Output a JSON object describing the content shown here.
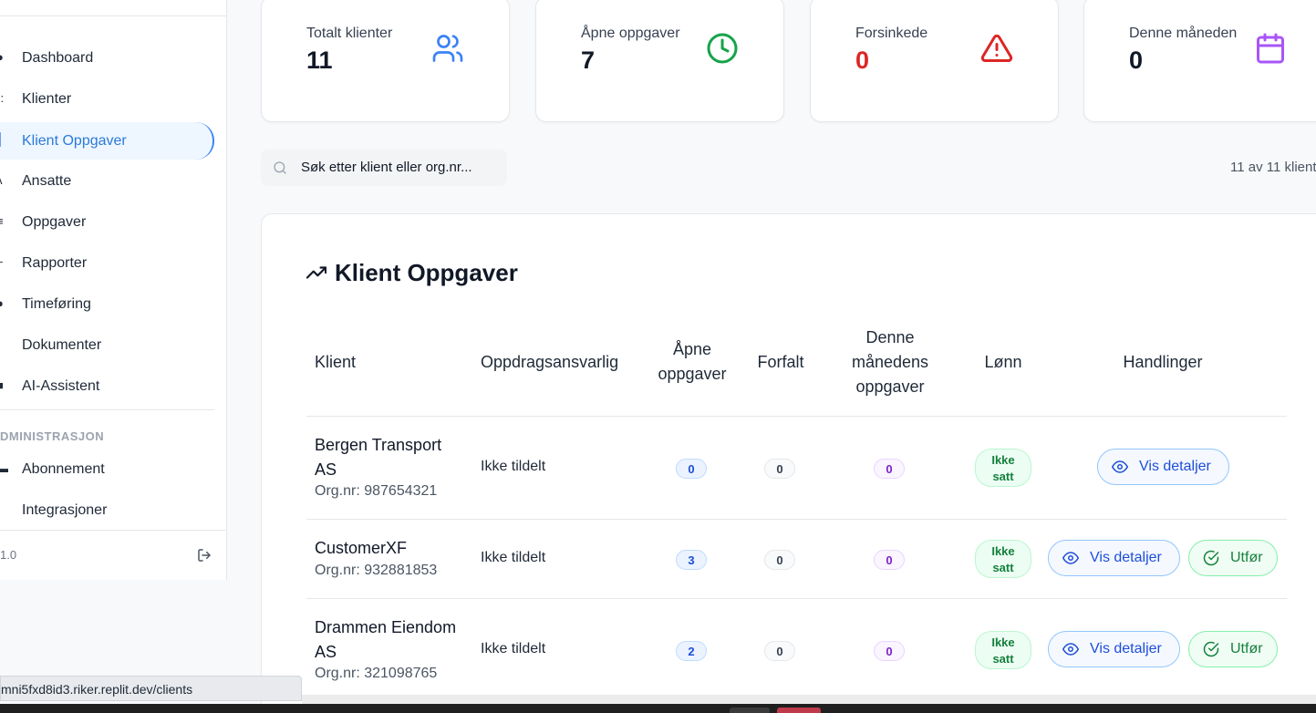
{
  "sidebar": {
    "items": [
      {
        "label": "Dashboard",
        "icon": "dashboard-icon"
      },
      {
        "label": "Klienter",
        "icon": "users-icon"
      },
      {
        "label": "Klient Oppgaver",
        "icon": "clipboard-icon",
        "active": true
      },
      {
        "label": "Ansatte",
        "icon": "person-icon"
      },
      {
        "label": "Oppgaver",
        "icon": "list-icon"
      },
      {
        "label": "Rapporter",
        "icon": "chart-icon"
      },
      {
        "label": "Timeføring",
        "icon": "clock-icon"
      },
      {
        "label": "Dokumenter",
        "icon": "file-icon"
      },
      {
        "label": "AI-Assistent",
        "icon": "bot-icon"
      }
    ],
    "admin_section": "DMINISTRASJON",
    "admin_items": [
      {
        "label": "Abonnement",
        "icon": "card-icon"
      },
      {
        "label": "Integrasjoner",
        "icon": "plug-icon"
      }
    ],
    "version": "1.0",
    "logout_icon": "logout-icon"
  },
  "stats": [
    {
      "label": "Totalt klienter",
      "value": "11",
      "icon": "users-icon",
      "color": "#3b82f6"
    },
    {
      "label": "Åpne oppgaver",
      "value": "7",
      "icon": "clock-icon",
      "color": "#16a34a"
    },
    {
      "label": "Forsinkede",
      "value": "0",
      "icon": "warning-icon",
      "color": "#dc2626"
    },
    {
      "label": "Denne måneden",
      "value": "0",
      "icon": "calendar-icon",
      "color": "#a855f7"
    }
  ],
  "search": {
    "placeholder": "Søk etter klient eller org.nr...",
    "count_text": "11 av 11 klient"
  },
  "panel": {
    "title": "Klient Oppgaver",
    "title_icon": "trending-up-icon"
  },
  "table": {
    "headers": {
      "client": "Klient",
      "responsible": "Oppdragsansvarlig",
      "open_line1": "Åpne",
      "open_line2": "oppgaver",
      "overdue": "Forfalt",
      "month_line1": "Denne",
      "month_line2": "månedens",
      "month_line3": "oppgaver",
      "salary": "Lønn",
      "actions": "Handlinger"
    },
    "rows": [
      {
        "name_line1": "Bergen Transport",
        "name_line2": "AS",
        "org": "Org.nr: 987654321",
        "responsible": "Ikke tildelt",
        "open": "0",
        "overdue": "0",
        "month": "0",
        "salary_line1": "Ikke",
        "salary_line2": "satt",
        "details": "Vis detaljer"
      },
      {
        "name_line1": "CustomerXF",
        "name_line2": "",
        "org": "Org.nr: 932881853",
        "responsible": "Ikke tildelt",
        "open": "3",
        "overdue": "0",
        "month": "0",
        "salary_line1": "Ikke",
        "salary_line2": "satt",
        "details": "Vis detaljer",
        "execute": "Utfør"
      },
      {
        "name_line1": "Drammen Eiendom",
        "name_line2": "AS",
        "org": "Org.nr: 321098765",
        "responsible": "Ikke tildelt",
        "open": "2",
        "overdue": "0",
        "month": "0",
        "salary_line1": "Ikke",
        "salary_line2": "satt",
        "details": "Vis detaljer",
        "execute": "Utfør"
      }
    ]
  },
  "statusbar": {
    "url": "mni5fxd8id3.riker.replit.dev/clients"
  },
  "colors": {
    "accent": "#2563eb",
    "active_bg": "#eef6ff",
    "success": "#15803d",
    "danger": "#dc2626"
  }
}
